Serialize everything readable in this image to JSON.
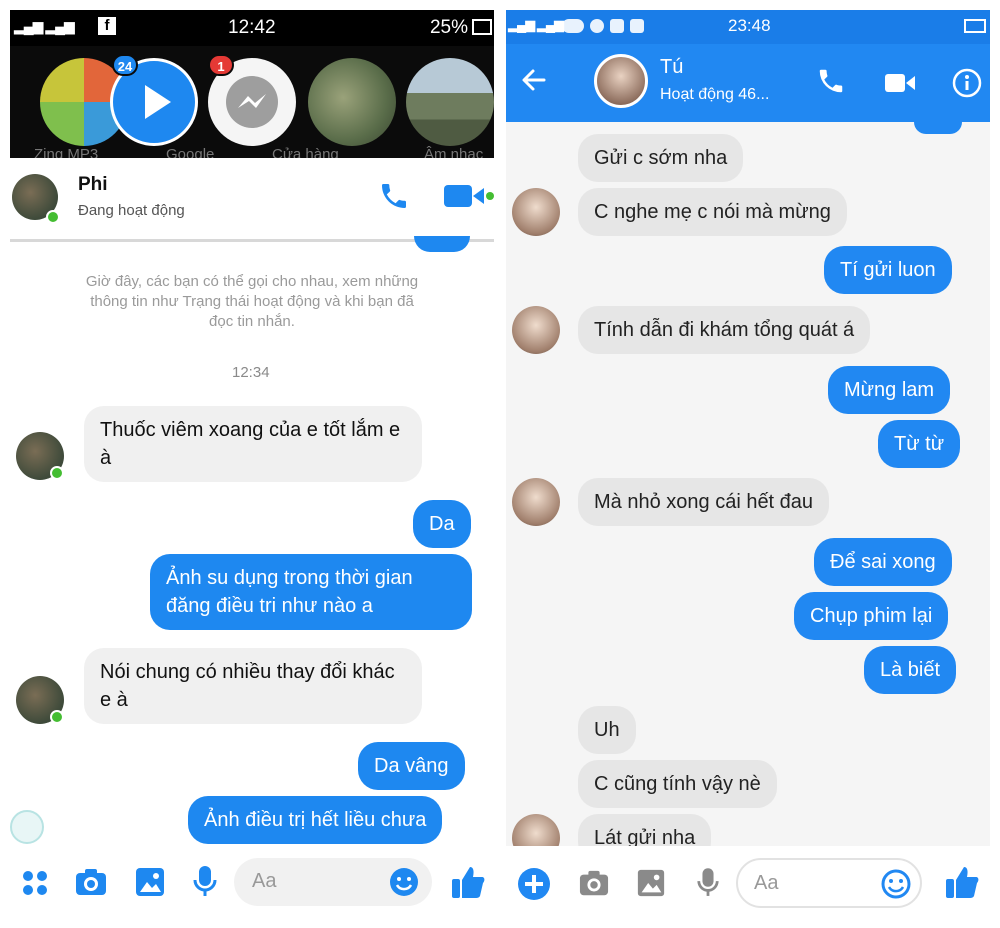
{
  "left": {
    "status_bar": {
      "time": "12:42",
      "battery": "25%"
    },
    "chat_heads": [
      {
        "label": "Zing MP3",
        "color": "#e2663a"
      },
      {
        "label": "",
        "badge": "24",
        "color": "#1e88f0"
      },
      {
        "label": "Google",
        "badge": "1",
        "color": "#f5f5f5"
      },
      {
        "label": "Cửa hàng",
        "color": "#5a6d4a"
      },
      {
        "label": "Âm nhạc",
        "color": "#6e7c5e"
      }
    ],
    "header": {
      "name": "Phi",
      "status": "Đang hoạt động"
    },
    "system_note": "Giờ đây, các bạn có thể gọi cho nhau, xem những thông tin như Trạng thái hoạt động và khi bạn đã đọc tin nhắn.",
    "timestamp": "12:34",
    "messages": [
      {
        "dir": "in",
        "text": "Thuốc viêm xoang của e tốt lắm e à"
      },
      {
        "dir": "out",
        "text": "Da"
      },
      {
        "dir": "out",
        "text": "Ảnh su dụng trong thời gian đăng điều tri như nào a"
      },
      {
        "dir": "in",
        "text": "Nói chung có nhiều thay đổi khác e à"
      },
      {
        "dir": "out",
        "text": "Da vâng"
      },
      {
        "dir": "out",
        "text": "Ảnh điều trị hết liều chưa"
      }
    ],
    "composer": {
      "placeholder": "Aa"
    },
    "colors": {
      "accent": "#1e88f0",
      "online": "#44bd32"
    }
  },
  "right": {
    "status_bar": {
      "time": "23:48"
    },
    "header": {
      "name": "Tú",
      "status": "Hoạt động 46..."
    },
    "messages": [
      {
        "dir": "in",
        "text": "Gửi c sớm nha"
      },
      {
        "dir": "in",
        "text": "C nghe mẹ c nói mà mừng"
      },
      {
        "dir": "out",
        "text": "Tí gửi luon"
      },
      {
        "dir": "in",
        "text": "Tính dẫn đi khám tổng quát á"
      },
      {
        "dir": "out",
        "text": "Mừng lam"
      },
      {
        "dir": "out",
        "text": "Từ từ"
      },
      {
        "dir": "in",
        "text": "Mà nhỏ xong cái hết đau"
      },
      {
        "dir": "out",
        "text": "Để sai xong"
      },
      {
        "dir": "out",
        "text": "Chụp phim lại"
      },
      {
        "dir": "out",
        "text": "Là biết"
      },
      {
        "dir": "in",
        "text": "Uh"
      },
      {
        "dir": "in",
        "text": "C cũng tính vậy nè"
      },
      {
        "dir": "in",
        "text": "Lát gửi nha"
      }
    ],
    "composer": {
      "placeholder": "Aa"
    },
    "colors": {
      "accent": "#2188f2"
    }
  }
}
